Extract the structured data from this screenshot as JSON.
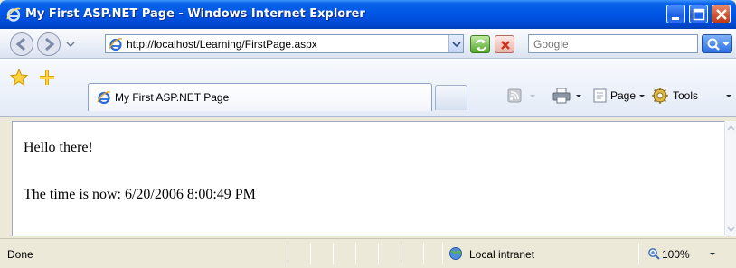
{
  "window": {
    "title": "My First ASP.NET Page - Windows Internet Explorer",
    "accent": "#0055e5",
    "close_color": "#d5532f"
  },
  "icons": {
    "title": "ie-logo-icon",
    "back": "back-arrow-icon",
    "forward": "forward-arrow-icon",
    "go": "refresh-icon",
    "stop": "stop-icon",
    "search": "search-icon",
    "favorites": "favorites-star-icon",
    "add_favorite": "add-favorite-icon",
    "feeds": "feeds-icon",
    "print": "print-icon",
    "page": "page-icon",
    "tools": "gear-icon",
    "zone": "local-intranet-icon",
    "zoom": "zoom-icon"
  },
  "address_bar": {
    "url": "http://localhost/Learning/FirstPage.aspx"
  },
  "search": {
    "placeholder": "Google"
  },
  "tab": {
    "label": "My First ASP.NET Page"
  },
  "command_bar": {
    "page_label": "Page",
    "tools_label": "Tools"
  },
  "page": {
    "line1": "Hello there!",
    "line2": "The time is now: 6/20/2006 8:00:49 PM"
  },
  "status": {
    "text": "Done",
    "zone": "Local intranet",
    "zoom": "100%"
  }
}
